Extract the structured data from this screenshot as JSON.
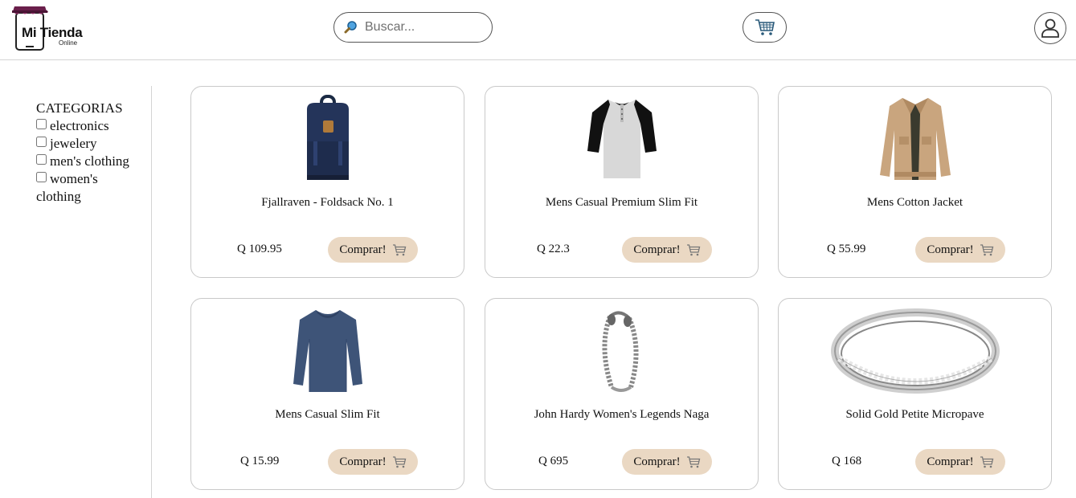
{
  "header": {
    "logo_title": "Mi Tienda",
    "logo_subtitle": "Online",
    "search_placeholder": "Buscar...",
    "search_icon": "magnifier-icon",
    "cart_icon": "shopping-cart-icon",
    "user_icon": "user-icon"
  },
  "sidebar": {
    "title": "CATEGORIAS",
    "categories": [
      {
        "label": "electronics",
        "checked": false
      },
      {
        "label": "jewelery",
        "checked": false
      },
      {
        "label": "men's clothing",
        "checked": false
      },
      {
        "label": "women's clothing",
        "checked": false
      }
    ]
  },
  "products": [
    {
      "title": "Fjallraven - Foldsack No. 1",
      "price": "Q 109.95",
      "button": "Comprar!",
      "image": "backpack"
    },
    {
      "title": "Mens Casual Premium Slim Fit",
      "price": "Q 22.3",
      "button": "Comprar!",
      "image": "raglan-tshirt"
    },
    {
      "title": "Mens Cotton Jacket",
      "price": "Q 55.99",
      "button": "Comprar!",
      "image": "jacket"
    },
    {
      "title": "Mens Casual Slim Fit",
      "price": "Q 15.99",
      "button": "Comprar!",
      "image": "long-sleeve-shirt"
    },
    {
      "title": "John Hardy Women's Legends Naga",
      "price": "Q 695",
      "button": "Comprar!",
      "image": "bracelet"
    },
    {
      "title": "Solid Gold Petite Micropave",
      "price": "Q 168",
      "button": "Comprar!",
      "image": "ring"
    }
  ],
  "colors": {
    "button_bg": "#ead8c3",
    "logo_accent": "#6a1f4b",
    "border": "#c9c9c9"
  }
}
